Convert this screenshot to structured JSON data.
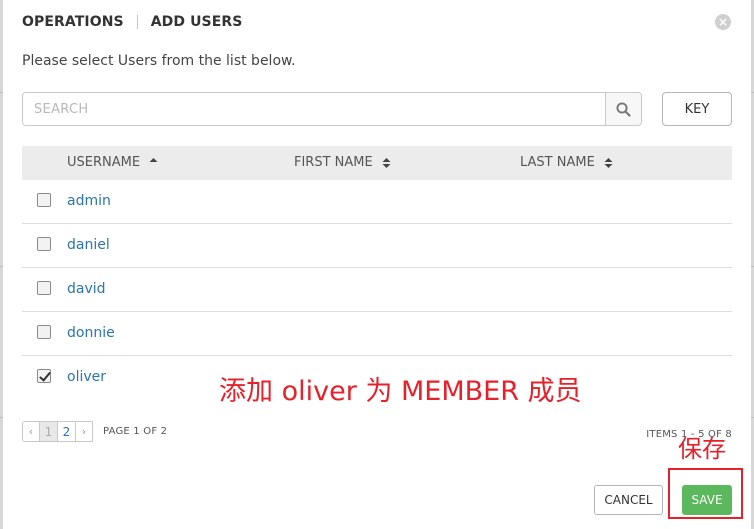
{
  "header": {
    "breadcrumb": [
      "OPERATIONS",
      "ADD USERS"
    ],
    "close_icon": "close-icon"
  },
  "instructions": "Please select Users from the list below.",
  "search": {
    "placeholder": "SEARCH",
    "value": "",
    "button_icon": "search-icon",
    "key_button": "KEY"
  },
  "table": {
    "columns": [
      {
        "label": "USERNAME",
        "sort": "ascending"
      },
      {
        "label": "FIRST NAME",
        "sort": "unsorted"
      },
      {
        "label": "LAST NAME",
        "sort": "unsorted"
      }
    ],
    "rows": [
      {
        "username": "admin",
        "first_name": "",
        "last_name": "",
        "checked": false
      },
      {
        "username": "daniel",
        "first_name": "",
        "last_name": "",
        "checked": false
      },
      {
        "username": "david",
        "first_name": "",
        "last_name": "",
        "checked": false
      },
      {
        "username": "donnie",
        "first_name": "",
        "last_name": "",
        "checked": false
      },
      {
        "username": "oliver",
        "first_name": "",
        "last_name": "",
        "checked": true
      }
    ]
  },
  "pagination": {
    "prev": "‹",
    "pages": [
      "1",
      "2"
    ],
    "current_page": "1",
    "next": "›",
    "page_label": "PAGE 1 OF 2",
    "items_label": "ITEMS 1 - 5 OF 8"
  },
  "annotations": {
    "note_add_member": "添加 oliver 为 MEMBER 成员",
    "note_save": "保存",
    "color": "#e8202a"
  },
  "footer": {
    "cancel_label": "CANCEL",
    "save_label": "SAVE"
  },
  "colors": {
    "link": "#2a74b5",
    "save_button": "#5cb85c",
    "header_bg": "#ececec"
  }
}
